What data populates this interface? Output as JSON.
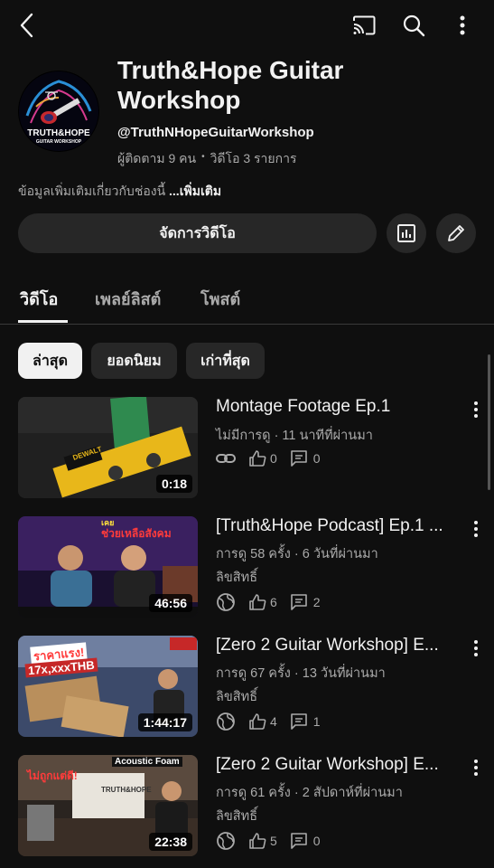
{
  "topbar": {
    "back_icon": "back-arrow-icon",
    "cast_icon": "cast-icon",
    "search_icon": "search-icon",
    "more_icon": "more-vertical-icon"
  },
  "channel": {
    "name_line1": "Truth&Hope Guitar",
    "name_line2": "Workshop",
    "handle": "@TruthNHopeGuitarWorkshop",
    "subscribers": "ผู้ติดตาม 9 คน",
    "separator": "•",
    "videos_count": "วิดีโอ 3 รายการ",
    "description": "ข้อมูลเพิ่มเติมเกี่ยวกับช่องนี้ ",
    "more_label": "...เพิ่มเติม",
    "avatar_line1": "TRUTH&HOPE",
    "avatar_line2": "GUITAR WORKSHOP"
  },
  "actions": {
    "manage_videos": "จัดการวิดีโอ",
    "analytics_icon": "analytics-icon",
    "edit_icon": "pencil-icon"
  },
  "tabs": [
    {
      "label": "วิดีโอ",
      "active": true
    },
    {
      "label": "เพลย์ลิสต์",
      "active": false
    },
    {
      "label": "โพสต์",
      "active": false
    }
  ],
  "chips": [
    {
      "label": "ล่าสุด",
      "active": true
    },
    {
      "label": "ยอดนิยม",
      "active": false
    },
    {
      "label": "เก่าที่สุด",
      "active": false
    }
  ],
  "videos": [
    {
      "title": "Montage Footage Ep.1",
      "meta": "ไม่มีการดู · 11 นาทีที่ผ่านมา",
      "license": "",
      "visibility_icon": "link-icon",
      "likes": "0",
      "comments": "0",
      "duration": "0:18"
    },
    {
      "title": "[Truth&Hope Podcast] Ep.1 ...",
      "meta": "การดู 58 ครั้ง · 6 วันที่ผ่านมา",
      "license": "ลิขสิทธิ์",
      "visibility_icon": "globe-icon",
      "likes": "6",
      "comments": "2",
      "duration": "46:56"
    },
    {
      "title": "[Zero 2 Guitar Workshop] E...",
      "meta": "การดู 67 ครั้ง · 13 วันที่ผ่านมา",
      "license": "ลิขสิทธิ์",
      "visibility_icon": "globe-icon",
      "likes": "4",
      "comments": "1",
      "duration": "1:44:17"
    },
    {
      "title": "[Zero 2 Guitar Workshop] E...",
      "meta": "การดู 61 ครั้ง · 2 สัปดาห์ที่ผ่านมา",
      "license": "ลิขสิทธิ์",
      "visibility_icon": "globe-icon",
      "likes": "5",
      "comments": "0",
      "duration": "22:38"
    }
  ],
  "thumb_text": {
    "v2_a": "ช่วยเหลือสังคม",
    "v2_b": "เคย",
    "v3_a": "ราคาแรง!",
    "v3_b": "17x,xxxTHB",
    "v4_a": "Acoustic Foam",
    "v4_b": "ไม่ถูกแต่ดี!",
    "v1_a": "DEWALT"
  }
}
